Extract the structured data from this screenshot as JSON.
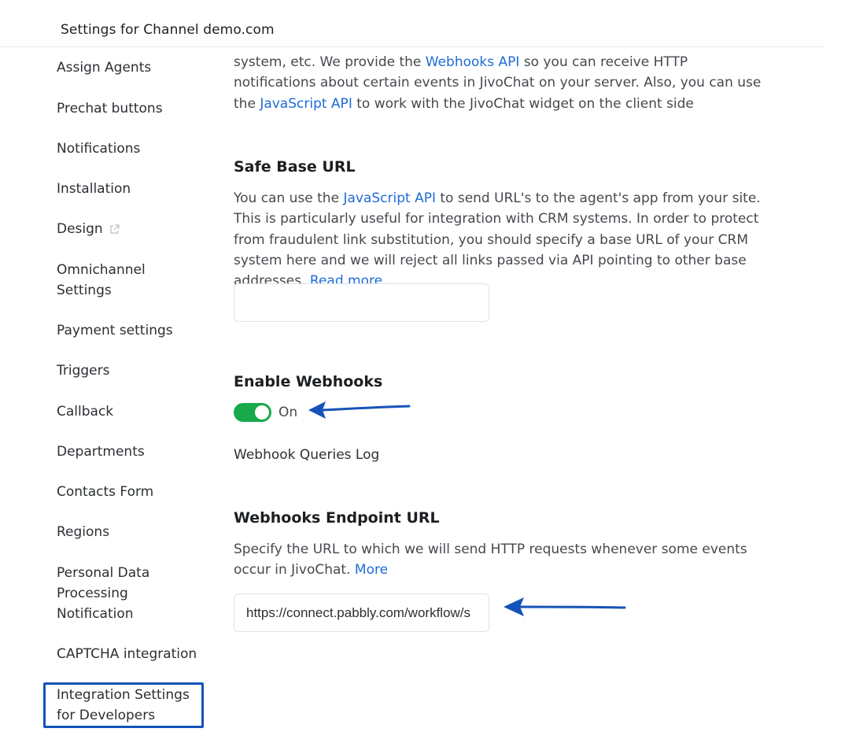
{
  "header": {
    "title": "Settings for Channel demo.com"
  },
  "sidebar": {
    "items": [
      {
        "label": "Assign Agents"
      },
      {
        "label": "Prechat buttons"
      },
      {
        "label": "Notifications"
      },
      {
        "label": "Installation"
      },
      {
        "label": "Design",
        "icon": "external-link-icon"
      },
      {
        "label": "Omnichannel Settings"
      },
      {
        "label": "Payment settings"
      },
      {
        "label": "Triggers"
      },
      {
        "label": "Callback"
      },
      {
        "label": "Departments"
      },
      {
        "label": "Contacts Form"
      },
      {
        "label": "Regions"
      },
      {
        "label": "Personal Data Processing Notification"
      },
      {
        "label": "CAPTCHA integration"
      },
      {
        "label": "Integration Settings for Developers",
        "active": true
      }
    ]
  },
  "intro": {
    "text_1": "system, etc. We provide the ",
    "link_webhooks_api": "Webhooks API",
    "text_2": " so you can receive HTTP notifications about certain events in JivoChat on your server. Also, you can use the ",
    "link_javascript_api": "JavaScript API",
    "text_3": " to work with the JivoChat widget on the client side"
  },
  "safe_base_url": {
    "title": "Safe Base URL",
    "text_1": "You can use the ",
    "link_javascript_api": "JavaScript API",
    "text_2": " to send URL's to the agent's app from your site. This is particularly useful for integration with CRM systems. In order to protect from fraudulent link substitution, you should specify a base URL of your CRM system here and we will reject all links passed via API pointing to other base addresses. ",
    "link_read_more": "Read more",
    "text_3": ".",
    "input_value": ""
  },
  "enable_webhooks": {
    "title": "Enable Webhooks",
    "toggle_state": "On",
    "queries_log_link": "Webhook Queries Log"
  },
  "webhooks_endpoint": {
    "title": "Webhooks Endpoint URL",
    "text_1": "Specify the URL to which we will send HTTP requests whenever some events occur in JivoChat. ",
    "link_more": "More",
    "input_value": "https://connect.pabbly.com/workflow/s"
  },
  "colors": {
    "accent_link": "#1e6bd6",
    "toggle_on": "#17a94a",
    "annotation_blue": "#1653b8"
  }
}
